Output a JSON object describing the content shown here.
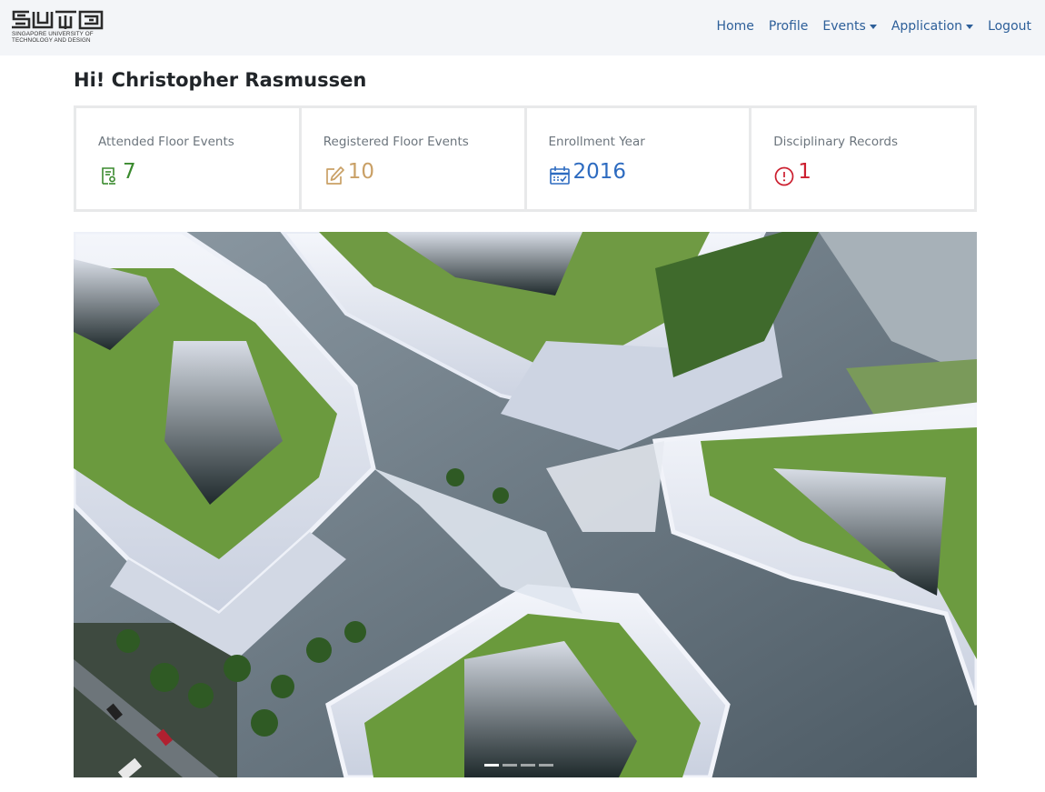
{
  "brand": {
    "logo_text": "SUTD",
    "caption": "SINGAPORE UNIVERSITY OF\nTECHNOLOGY AND DESIGN"
  },
  "nav": {
    "home": "Home",
    "profile": "Profile",
    "events": "Events",
    "application": "Application",
    "logout": "Logout",
    "link_color": "#2d5f99"
  },
  "greeting": "Hi! Christopher Rasmussen",
  "stats": [
    {
      "label": "Attended Floor Events",
      "value": "7",
      "color": "#3a8a2e",
      "icon": "certificate-icon"
    },
    {
      "label": "Registered Floor Events",
      "value": "10",
      "color": "#c9a066",
      "icon": "edit-icon"
    },
    {
      "label": "Enrollment Year",
      "value": "2016",
      "color": "#2d6bc0",
      "icon": "calendar-check-icon"
    },
    {
      "label": "Disciplinary Records",
      "value": "1",
      "color": "#cc1f2f",
      "icon": "alert-circle-icon"
    }
  ],
  "carousel": {
    "slides": 4,
    "active_slide": 1
  }
}
